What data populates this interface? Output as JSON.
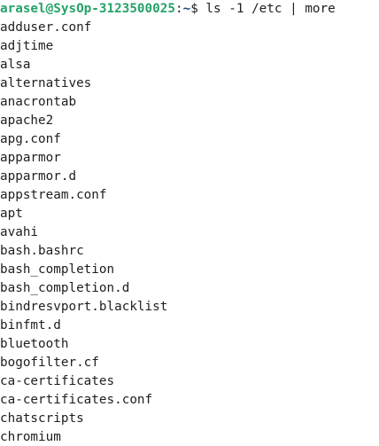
{
  "prompt": {
    "user_host": "arasel@SysOp-3123500025",
    "colon": ":",
    "path": "~",
    "symbol": "$ ",
    "command": "ls -1 /etc | more"
  },
  "output": [
    "adduser.conf",
    "adjtime",
    "alsa",
    "alternatives",
    "anacrontab",
    "apache2",
    "apg.conf",
    "apparmor",
    "apparmor.d",
    "appstream.conf",
    "apt",
    "avahi",
    "bash.bashrc",
    "bash_completion",
    "bash_completion.d",
    "bindresvport.blacklist",
    "binfmt.d",
    "bluetooth",
    "bogofilter.cf",
    "ca-certificates",
    "ca-certificates.conf",
    "chatscripts",
    "chromium"
  ],
  "colors": {
    "background": "#ffffff",
    "text": "#1e1e1e",
    "user_host": "#26a269",
    "path": "#12488b"
  }
}
